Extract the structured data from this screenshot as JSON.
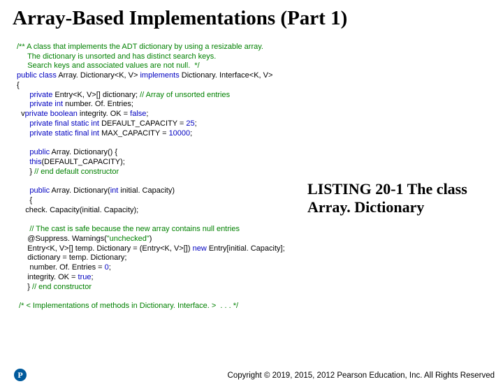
{
  "title": "Array-Based Implementations (Part 1)",
  "listing_caption_l1": "LISTING 20-1 The class",
  "listing_caption_l2": "Array. Dictionary",
  "footer": "Copyright © 2019, 2015, 2012 Pearson Education, Inc. All Rights Reserved",
  "logo": "P",
  "code": {
    "c1": "/** A class that implements the ADT dictionary by using a resizable array.",
    "c2": "     The dictionary is unsorted and has distinct search keys.",
    "c3": "     Search keys and associated values are not null.  */",
    "l1a": "public class ",
    "l1b": "Array. Dictionary<K, V> ",
    "l1c": "implements ",
    "l1d": "Dictionary. Interface<K, V>",
    "l2": "{",
    "l3a": "      private ",
    "l3b": "Entry<K, V>[] dictionary; ",
    "l3c": "// Array of unsorted entries",
    "l4a": "      private int ",
    "l4b": "number. Of. Entries;",
    "l5a": "  v",
    "l5b": "private boolean ",
    "l5c": "integrity. OK = ",
    "l5d": "false",
    "l5e": ";",
    "l6a": "      private final static int ",
    "l6b": "DEFAULT_CAPACITY = ",
    "l6c": "25",
    "l6d": ";",
    "l7a": "      private static final int ",
    "l7b": "MAX_CAPACITY = ",
    "l7c": "10000",
    "l7d": ";",
    "l8a": "      public ",
    "l8b": "Array. Dictionary() {",
    "l9a": "      this",
    "l9b": "(DEFAULT_CAPACITY);",
    "l10a": "      } ",
    "l10b": "// end default constructor",
    "l11a": "      public ",
    "l11b": "Array. Dictionary(",
    "l11c": "int ",
    "l11d": "initial. Capacity)",
    "l12": "      {",
    "l13": "    check. Capacity(initial. Capacity);",
    "l14": "      // The cast is safe because the new array contains null entries",
    "l15a": "     @Suppress. Warnings(",
    "l15b": "\"unchecked\"",
    "l15c": ")",
    "l16a": "     Entry<K, V>[] temp. Dictionary = (Entry<K, V>[]) ",
    "l16b": "new ",
    "l16c": "Entry[initial. Capacity];",
    "l17": "     dictionary = temp. Dictionary;",
    "l18a": "      number. Of. Entries = ",
    "l18b": "0",
    "l18c": ";",
    "l19a": "     integrity. OK = ",
    "l19b": "true",
    "l19c": ";",
    "l20a": "     } ",
    "l20b": "// end constructor",
    "l21": " /* < Implementations of methods in Dictionary. Interface. >  . . . */"
  }
}
